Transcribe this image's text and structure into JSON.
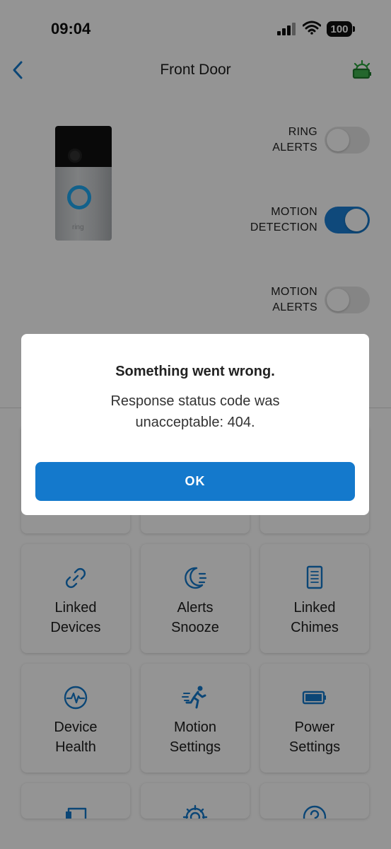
{
  "status_bar": {
    "time": "09:04",
    "battery": "100"
  },
  "nav": {
    "title": "Front Door"
  },
  "device": {
    "brand_mark": "ring"
  },
  "toggles": [
    {
      "line1": "RING",
      "line2": "ALERTS",
      "state": "off"
    },
    {
      "line1": "MOTION",
      "line2": "DETECTION",
      "state": "on"
    },
    {
      "line1": "MOTION",
      "line2": "ALERTS",
      "state": "off"
    }
  ],
  "tiles": [
    {
      "line1": "Linked",
      "line2": "Devices",
      "icon": "link-icon"
    },
    {
      "line1": "Alerts",
      "line2": "Snooze",
      "icon": "snooze-moon-icon"
    },
    {
      "line1": "Linked",
      "line2": "Chimes",
      "icon": "chime-icon"
    },
    {
      "line1": "Device",
      "line2": "Health",
      "icon": "heartbeat-icon"
    },
    {
      "line1": "Motion",
      "line2": "Settings",
      "icon": "running-person-icon"
    },
    {
      "line1": "Power",
      "line2": "Settings",
      "icon": "battery-icon"
    },
    {
      "line1": "",
      "line2": "",
      "icon": "chat-icon"
    },
    {
      "line1": "",
      "line2": "",
      "icon": "gear-icon"
    },
    {
      "line1": "",
      "line2": "",
      "icon": "help-icon"
    }
  ],
  "dialog": {
    "title": "Something went wrong.",
    "message": "Response status code was unacceptable: 404.",
    "button": "OK"
  },
  "colors": {
    "accent": "#1479cc",
    "toggle_on": "#1a7fd4",
    "doorbell_ring": "#1fa7f0"
  }
}
